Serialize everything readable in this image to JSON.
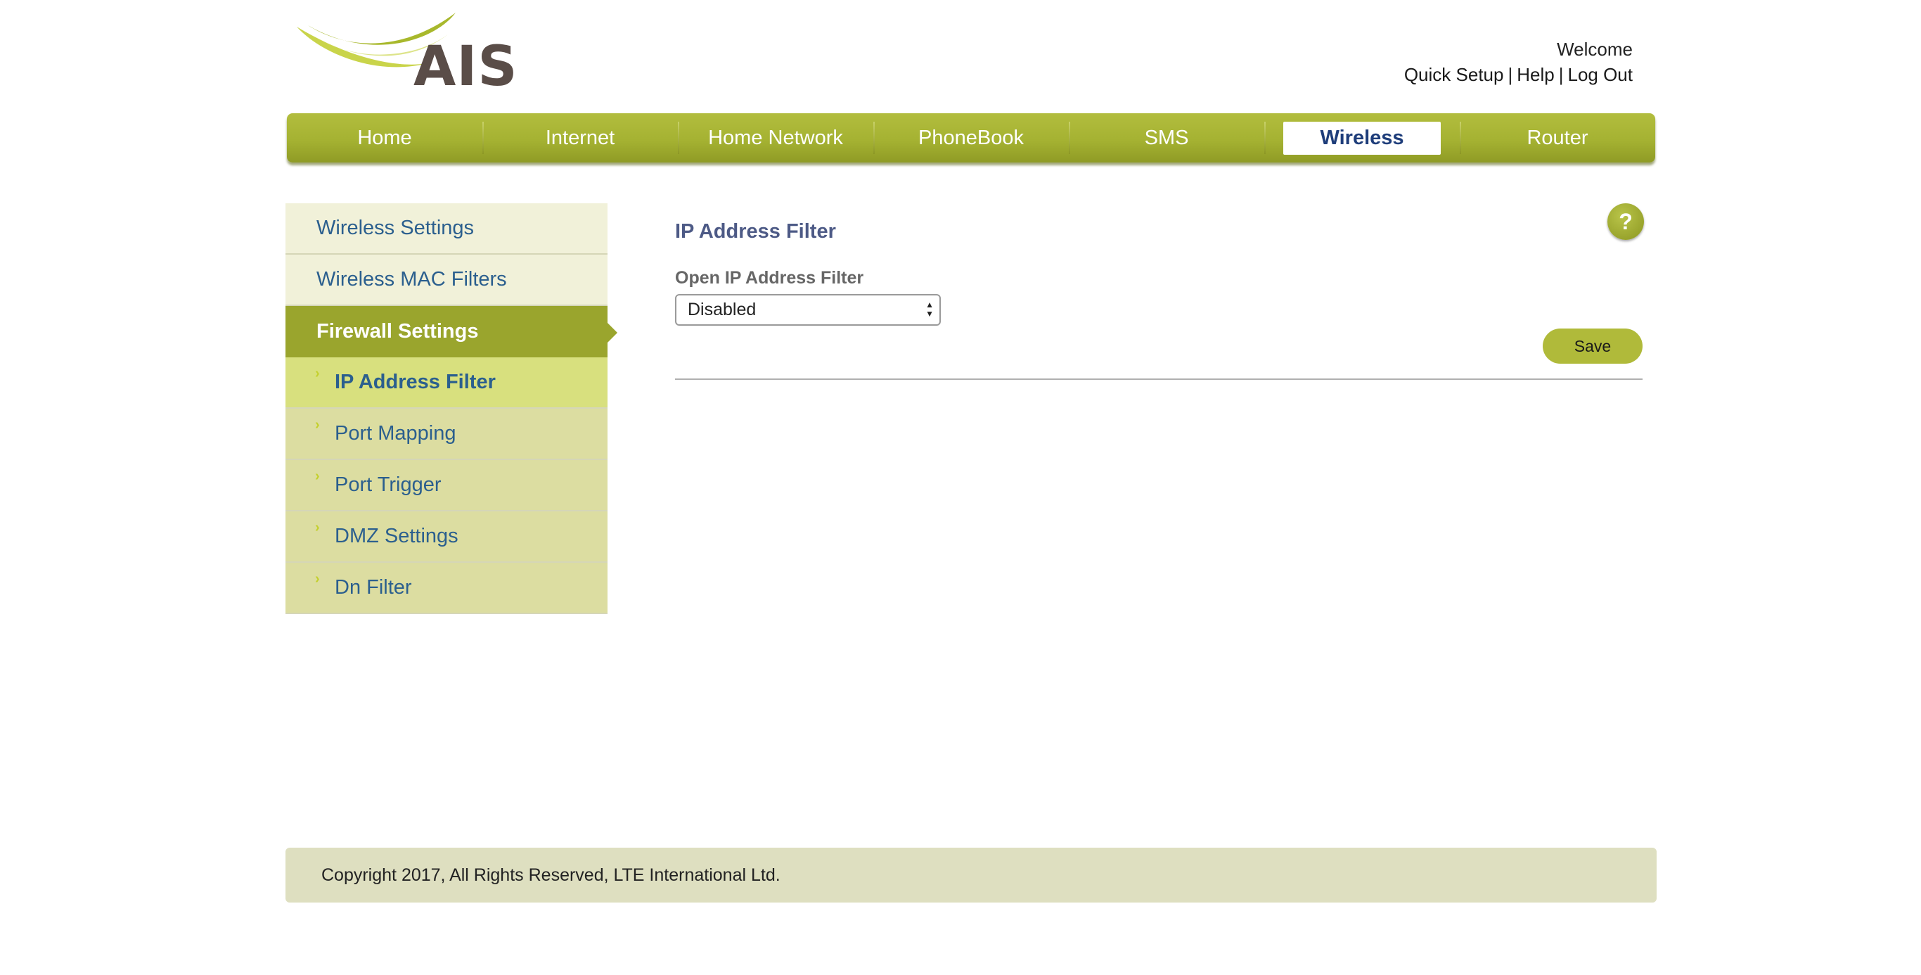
{
  "brand": {
    "name": "AIS",
    "logo_icon": "ais-swoosh-logo",
    "accent_color": "#a5b232"
  },
  "header": {
    "welcome": "Welcome",
    "links": {
      "quick_setup": "Quick Setup",
      "help": "Help",
      "logout": "Log Out",
      "separator": "|"
    }
  },
  "nav": {
    "items": [
      {
        "label": "Home",
        "active": false
      },
      {
        "label": "Internet",
        "active": false
      },
      {
        "label": "Home Network",
        "active": false
      },
      {
        "label": "PhoneBook",
        "active": false
      },
      {
        "label": "SMS",
        "active": false
      },
      {
        "label": "Wireless",
        "active": true
      },
      {
        "label": "Router",
        "active": false
      }
    ]
  },
  "sidebar": {
    "items": [
      {
        "label": "Wireless Settings"
      },
      {
        "label": "Wireless MAC Filters"
      },
      {
        "label": "Firewall Settings"
      },
      {
        "label": "IP Address Filter"
      },
      {
        "label": "Port Mapping"
      },
      {
        "label": "Port Trigger"
      },
      {
        "label": "DMZ Settings"
      },
      {
        "label": "Dn Filter"
      }
    ],
    "chevron": "›"
  },
  "main": {
    "title": "IP Address Filter",
    "help_icon": "question-mark-icon",
    "help_glyph": "?",
    "field_label": "Open IP Address Filter",
    "select_value": "Disabled",
    "save_label": "Save"
  },
  "footer": {
    "copyright": "Copyright 2017, All Rights Reserved, LTE International Ltd."
  }
}
